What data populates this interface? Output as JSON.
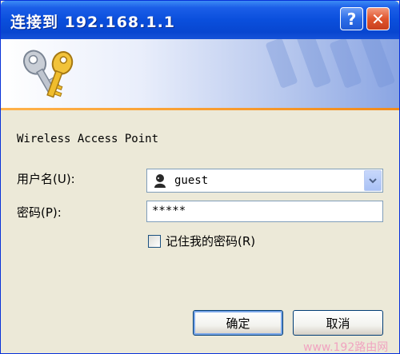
{
  "window": {
    "title": "连接到 192.168.1.1",
    "help_label": "?",
    "close_label": "✕"
  },
  "banner": {
    "icon": "keys-icon",
    "accent_stripe_color": "#f28b1a"
  },
  "prompt": {
    "realm": "Wireless Access Point"
  },
  "form": {
    "username_label": "用户名(U):",
    "username_value": "guest",
    "username_icon": "user-icon",
    "password_label": "密码(P):",
    "password_value": "*****",
    "remember_label": "记住我的密码(R)",
    "remember_checked": false
  },
  "buttons": {
    "ok_label": "确定",
    "cancel_label": "取消"
  },
  "watermark": {
    "text": "www.192路由网"
  },
  "colors": {
    "titlebar": "#0a4fdc",
    "window_bg": "#ece9d8",
    "close_button": "#e0552d"
  }
}
